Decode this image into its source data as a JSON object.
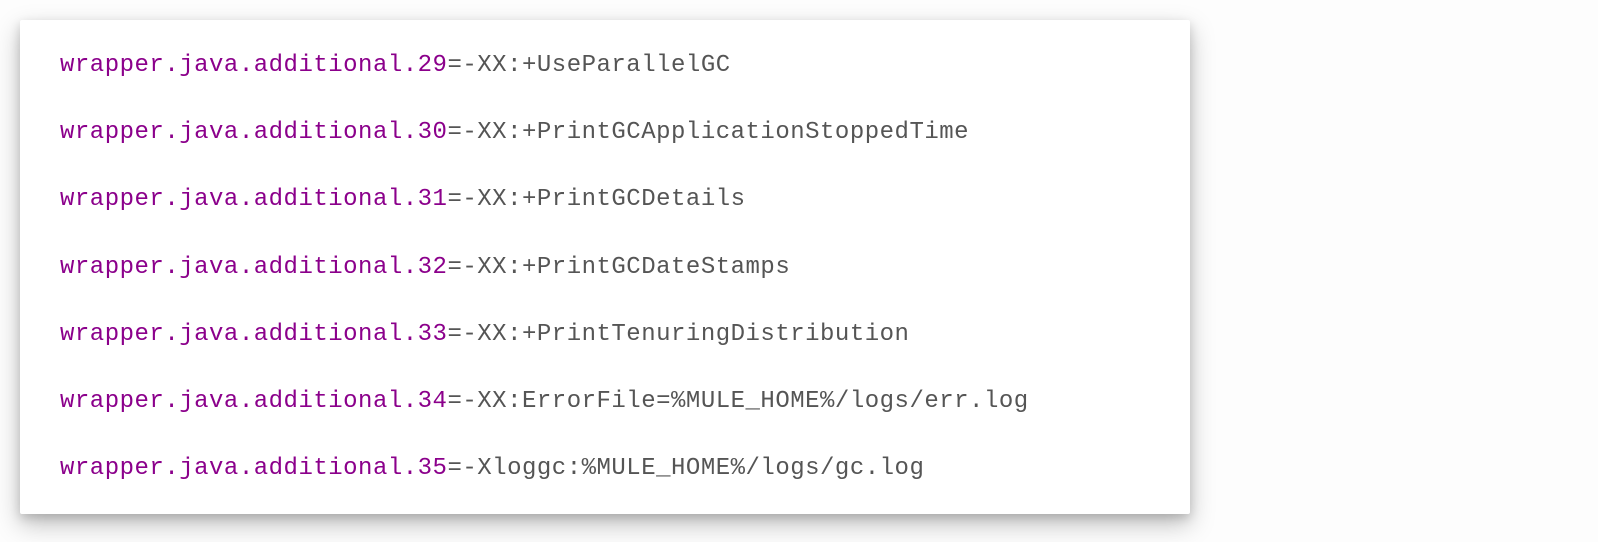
{
  "config": {
    "lines": [
      {
        "key": "wrapper.java.additional.29",
        "value": "-XX:+UseParallelGC"
      },
      {
        "key": "wrapper.java.additional.30",
        "value": "-XX:+PrintGCApplicationStoppedTime"
      },
      {
        "key": "wrapper.java.additional.31",
        "value": "-XX:+PrintGCDetails"
      },
      {
        "key": "wrapper.java.additional.32",
        "value": "-XX:+PrintGCDateStamps"
      },
      {
        "key": "wrapper.java.additional.33",
        "value": "-XX:+PrintTenuringDistribution"
      },
      {
        "key": "wrapper.java.additional.34",
        "value": "-XX:ErrorFile=%MULE_HOME%/logs/err.log"
      },
      {
        "key": "wrapper.java.additional.35",
        "value": "-Xloggc:%MULE_HOME%/logs/gc.log"
      }
    ],
    "separator": "="
  },
  "colors": {
    "key_color": "#8b008b",
    "value_color": "#555555",
    "background": "#ffffff"
  }
}
